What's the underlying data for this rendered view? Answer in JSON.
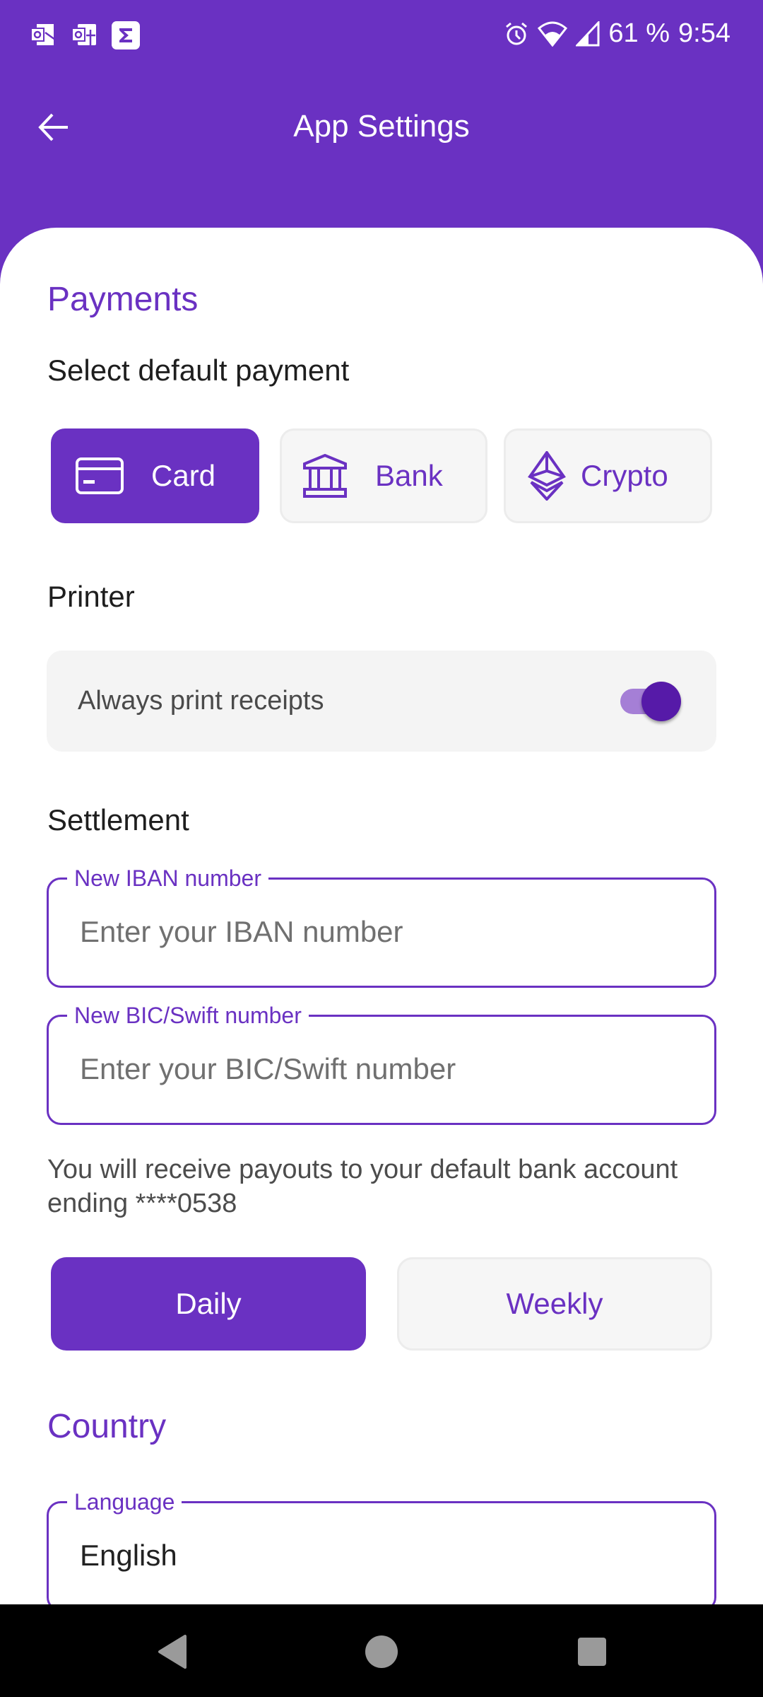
{
  "status_bar": {
    "notification_icons": [
      "outlook-icon",
      "office-icon",
      "sigma-app-icon"
    ],
    "system_icons": [
      "alarm-icon",
      "wifi-icon",
      "cell-signal-icon"
    ],
    "battery": "61 %",
    "time": "9:54"
  },
  "app_bar": {
    "back_icon": "arrow-left-icon",
    "title": "App Settings"
  },
  "payments": {
    "section_title": "Payments",
    "subtitle": "Select default payment",
    "options": [
      {
        "label": "Card",
        "icon": "credit-card-icon",
        "selected": true
      },
      {
        "label": "Bank",
        "icon": "bank-icon",
        "selected": false
      },
      {
        "label": "Crypto",
        "icon": "ethereum-icon",
        "selected": false
      }
    ]
  },
  "printer": {
    "subtitle": "Printer",
    "toggle_label": "Always print receipts",
    "toggle_on": true
  },
  "settlement": {
    "subtitle": "Settlement",
    "iban_field": {
      "label": "New IBAN number",
      "placeholder": "Enter your IBAN number",
      "value": ""
    },
    "bic_field": {
      "label": "New BIC/Swift number",
      "placeholder": "Enter your BIC/Swift number",
      "value": ""
    },
    "info_text": "You will receive payouts to your default bank account ending ****0538",
    "frequency_options": [
      {
        "label": "Daily",
        "selected": true
      },
      {
        "label": "Weekly",
        "selected": false
      }
    ]
  },
  "country": {
    "section_title": "Country",
    "language_field": {
      "label": "Language",
      "value": "English"
    }
  },
  "nav_bar": {
    "buttons": [
      "back-triangle-icon",
      "home-circle-icon",
      "recents-square-icon"
    ]
  },
  "colors": {
    "primary": "#6a31c2",
    "switch_thumb": "#561aa8",
    "switch_track": "#a57fd6",
    "unselected_bg": "#f6f6f6"
  }
}
